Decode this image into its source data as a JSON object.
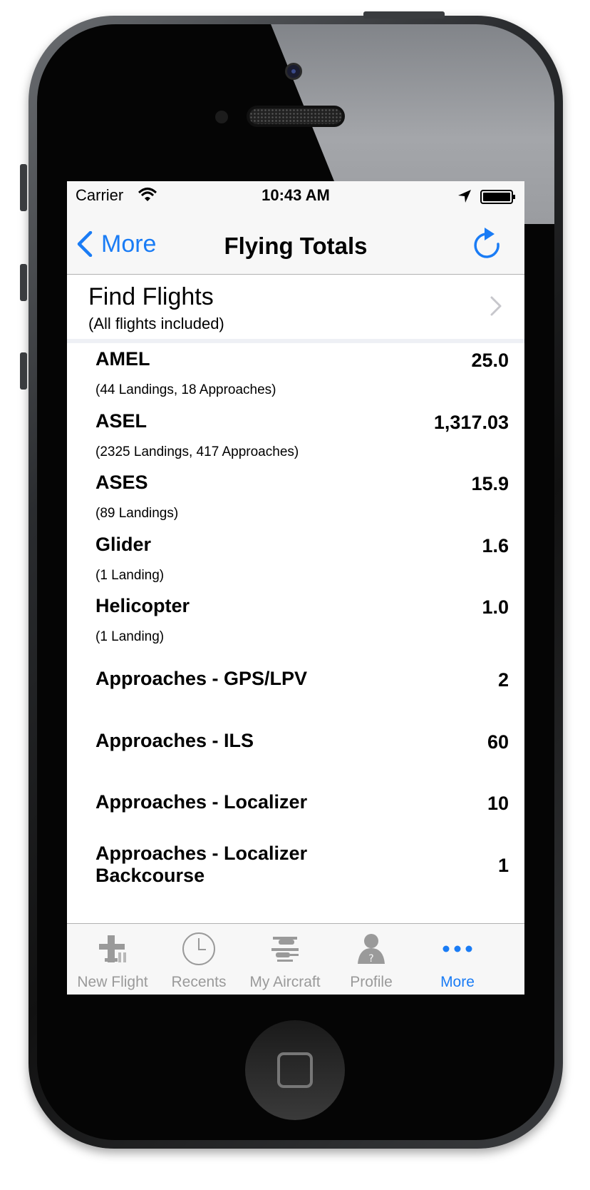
{
  "status_bar": {
    "carrier": "Carrier",
    "time": "10:43 AM"
  },
  "nav": {
    "back_label": "More",
    "title": "Flying Totals"
  },
  "find_flights": {
    "title": "Find Flights",
    "subtitle": "(All flights included)"
  },
  "totals": [
    {
      "label": "AMEL",
      "value": "25.0",
      "detail": "(44 Landings, 18 Approaches)"
    },
    {
      "label": "ASEL",
      "value": "1,317.03",
      "detail": "(2325 Landings, 417 Approaches)"
    },
    {
      "label": "ASES",
      "value": "15.9",
      "detail": "(89 Landings)"
    },
    {
      "label": "Glider",
      "value": "1.6",
      "detail": "(1 Landing)"
    },
    {
      "label": "Helicopter",
      "value": "1.0",
      "detail": "(1 Landing)"
    },
    {
      "label": "Approaches - GPS/LPV",
      "value": "2",
      "detail": ""
    },
    {
      "label": "Approaches - ILS",
      "value": "60",
      "detail": ""
    },
    {
      "label": "Approaches - Localizer",
      "value": "10",
      "detail": ""
    },
    {
      "label": "Approaches - Localizer Backcourse",
      "value": "1",
      "detail": ""
    }
  ],
  "tabs": [
    {
      "label": "New Flight",
      "icon": "new-flight-icon"
    },
    {
      "label": "Recents",
      "icon": "clock-icon"
    },
    {
      "label": "My Aircraft",
      "icon": "aircraft-icon"
    },
    {
      "label": "Profile",
      "icon": "profile-icon"
    },
    {
      "label": "More",
      "icon": "more-dots-icon"
    }
  ],
  "colors": {
    "accent": "#1a7cf5",
    "tab_inactive": "#9a9a9a",
    "bar_bg": "#f7f7f7"
  }
}
